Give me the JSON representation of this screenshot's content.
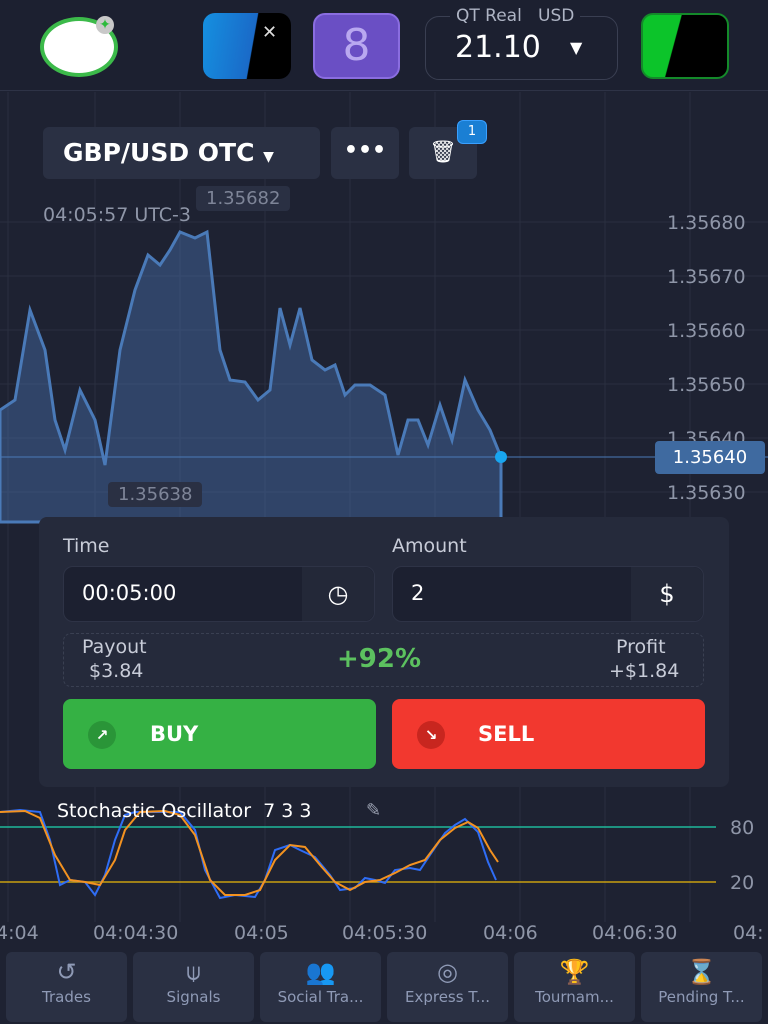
{
  "header": {
    "account_label": "QT Real",
    "currency": "USD",
    "balance": "21.10"
  },
  "asset": {
    "pair": "GBP/USD OTC",
    "more": "•••",
    "trash_badge": "1"
  },
  "chart": {
    "time": "04:05:57 UTC-3",
    "high": "1.35682",
    "low": "1.35638",
    "current": "1.35640",
    "y_labels": [
      "1.35680",
      "1.35670",
      "1.35660",
      "1.35650",
      "1.35640",
      "1.35630"
    ]
  },
  "trade": {
    "time_label": "Time",
    "time_value": "00:05:00",
    "amount_label": "Amount",
    "amount_value": "2",
    "payout_label": "Payout",
    "payout_value": "$3.84",
    "percent": "+92%",
    "profit_label": "Profit",
    "profit_value": "+$1.84",
    "buy": "BUY",
    "sell": "SELL",
    "buy_color": "#35b144",
    "sell_color": "#f2382f"
  },
  "indicator": {
    "name": "Stochastic Oscillator",
    "params": "7 3 3",
    "upper": "80",
    "lower": "20"
  },
  "x_labels": [
    "4:04",
    "04:04:30",
    "04:05",
    "04:05:30",
    "04:06",
    "04:06:30",
    "04:"
  ],
  "nav": [
    {
      "label": "Trades",
      "icon": "history-icon"
    },
    {
      "label": "Signals",
      "icon": "antenna-icon"
    },
    {
      "label": "Social Tra...",
      "icon": "users-icon"
    },
    {
      "label": "Express T...",
      "icon": "target-icon"
    },
    {
      "label": "Tournam...",
      "icon": "trophy-icon"
    },
    {
      "label": "Pending T...",
      "icon": "hourglass-icon"
    }
  ]
}
